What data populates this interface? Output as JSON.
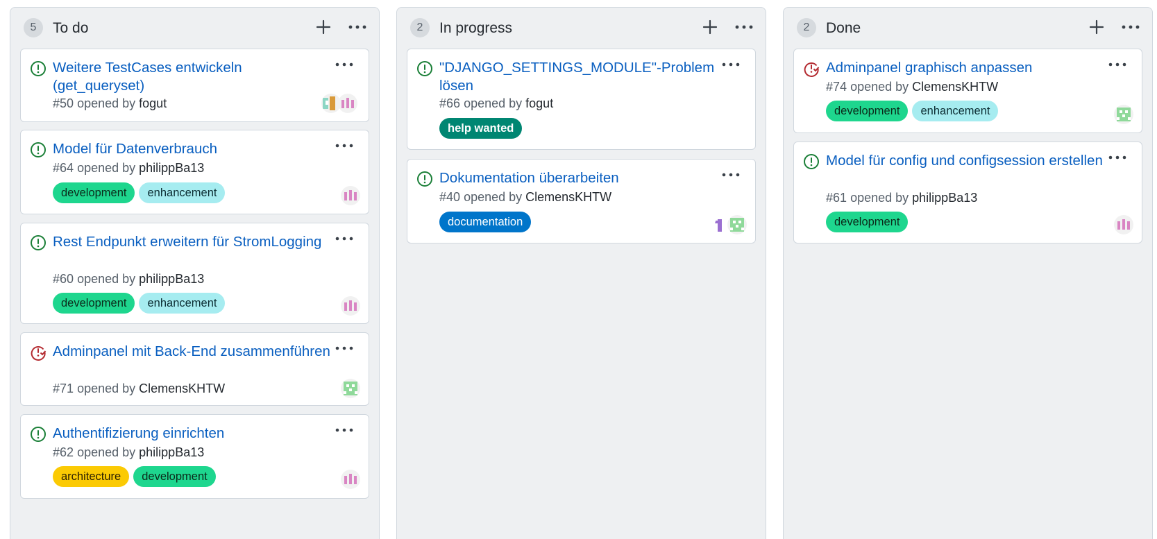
{
  "columns": [
    {
      "count": "5",
      "title": "To do",
      "cards": [
        {
          "title": "Weitere TestCases entwickeln (get_queryset)",
          "number": "#50",
          "opened_by": "opened by",
          "author": "fogut",
          "status": "open",
          "labels": [],
          "avatars": [
            "orange-green-identicon",
            "pink-identicon"
          ]
        },
        {
          "title": "Model für Datenverbrauch",
          "number": "#64",
          "opened_by": "opened by",
          "author": "philippBa13",
          "status": "open",
          "labels": [
            "development",
            "enhancement"
          ],
          "avatars": [
            "pink-identicon"
          ]
        },
        {
          "title": "Rest Endpunkt erweitern für StromLogging",
          "number": "#60",
          "opened_by": "opened by",
          "author": "philippBa13",
          "status": "open",
          "labels": [
            "development",
            "enhancement"
          ],
          "avatars": [
            "pink-identicon"
          ]
        },
        {
          "title": "Adminpanel mit Back-End zusammenführen",
          "number": "#71",
          "opened_by": "opened by",
          "author": "ClemensKHTW",
          "status": "closed",
          "labels": [],
          "avatars": [
            "green-identicon"
          ]
        },
        {
          "title": "Authentifizierung einrichten",
          "number": "#62",
          "opened_by": "opened by",
          "author": "philippBa13",
          "status": "open",
          "labels": [
            "architecture",
            "development"
          ],
          "avatars": [
            "pink-identicon"
          ]
        }
      ]
    },
    {
      "count": "2",
      "title": "In progress",
      "cards": [
        {
          "title": "\"DJANGO_SETTINGS_MODULE\"-Problem lösen",
          "number": "#66",
          "opened_by": "opened by",
          "author": "fogut",
          "status": "open",
          "labels": [
            "help wanted"
          ],
          "avatars": []
        },
        {
          "title": "Dokumentation überarbeiten",
          "number": "#40",
          "opened_by": "opened by",
          "author": "ClemensKHTW",
          "status": "open",
          "labels": [
            "documentation"
          ],
          "avatars": [
            "purple-identicon",
            "green-identicon"
          ]
        }
      ]
    },
    {
      "count": "2",
      "title": "Done",
      "cards": [
        {
          "title": "Adminpanel graphisch anpassen",
          "number": "#74",
          "opened_by": "opened by",
          "author": "ClemensKHTW",
          "status": "closed",
          "labels": [
            "development",
            "enhancement"
          ],
          "avatars": [
            "green-identicon"
          ]
        },
        {
          "title": "Model für config und configsession erstellen",
          "number": "#61",
          "opened_by": "opened by",
          "author": "philippBa13",
          "status": "open",
          "labels": [
            "development"
          ],
          "avatars": [
            "pink-identicon"
          ]
        }
      ]
    }
  ],
  "colors": {
    "open_icon": "#1a7f37",
    "closed_icon": "#b42b31",
    "link": "#0a5fc0",
    "development": "#1ed68e",
    "enhancement": "#a6ecf0",
    "architecture": "#fbca04",
    "help_wanted": "#008672",
    "documentation": "#0075ca"
  }
}
